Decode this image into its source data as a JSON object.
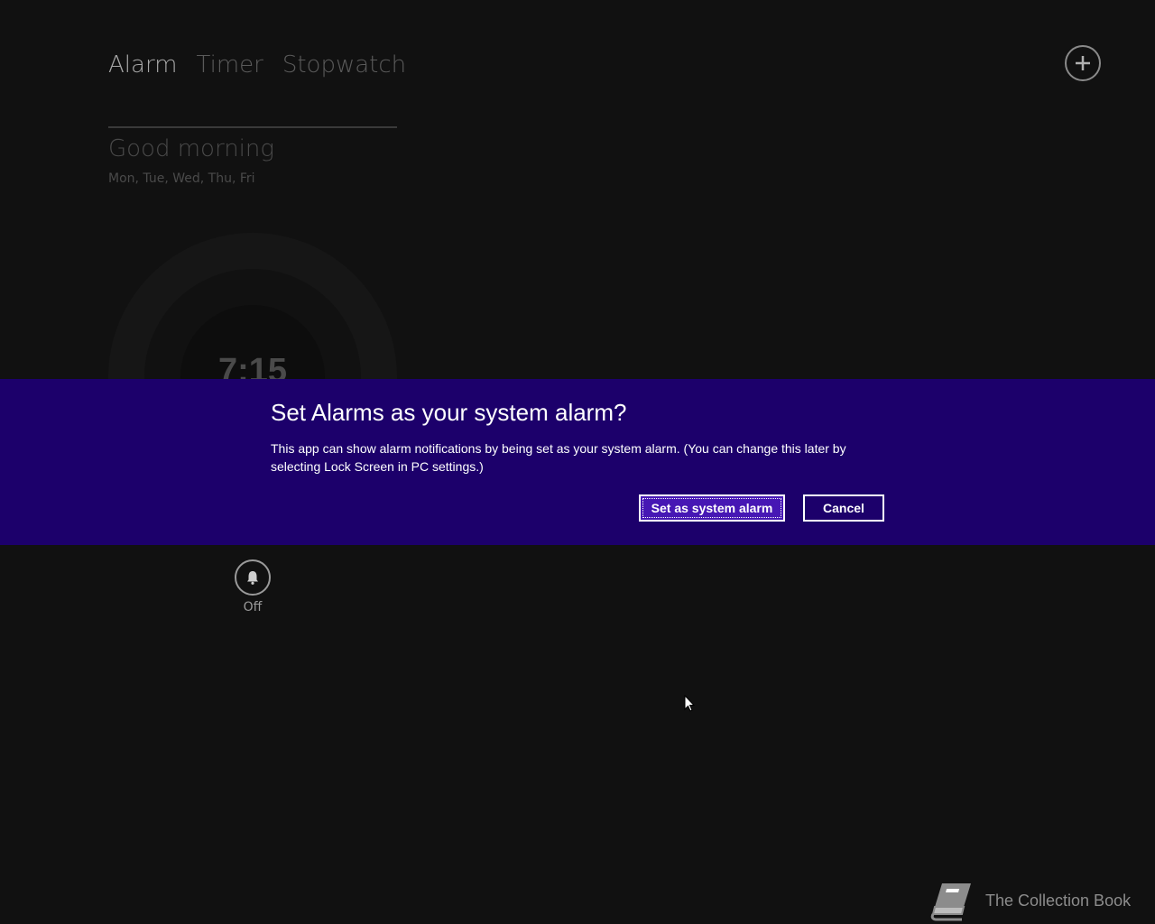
{
  "tabs": [
    {
      "label": "Alarm",
      "active": true
    },
    {
      "label": "Timer",
      "active": false
    },
    {
      "label": "Stopwatch",
      "active": false
    }
  ],
  "alarm": {
    "name": "Good morning",
    "days": "Mon, Tue, Wed, Thu, Fri",
    "time": "7:15",
    "toggle_label": "Off"
  },
  "dialog": {
    "title": "Set Alarms as your system alarm?",
    "body": "This app can show alarm notifications by being set as your system alarm. (You can change this later by selecting Lock Screen in PC settings.)",
    "primary_button": "Set as system alarm",
    "cancel_button": "Cancel",
    "background_color": "#1c006b",
    "accent_color": "#4617b4"
  },
  "watermark": {
    "text": "The Collection Book"
  },
  "icons": {
    "add": "plus-circle-icon",
    "bell": "bell-icon",
    "book": "book-icon",
    "cursor": "mouse-pointer-icon"
  }
}
